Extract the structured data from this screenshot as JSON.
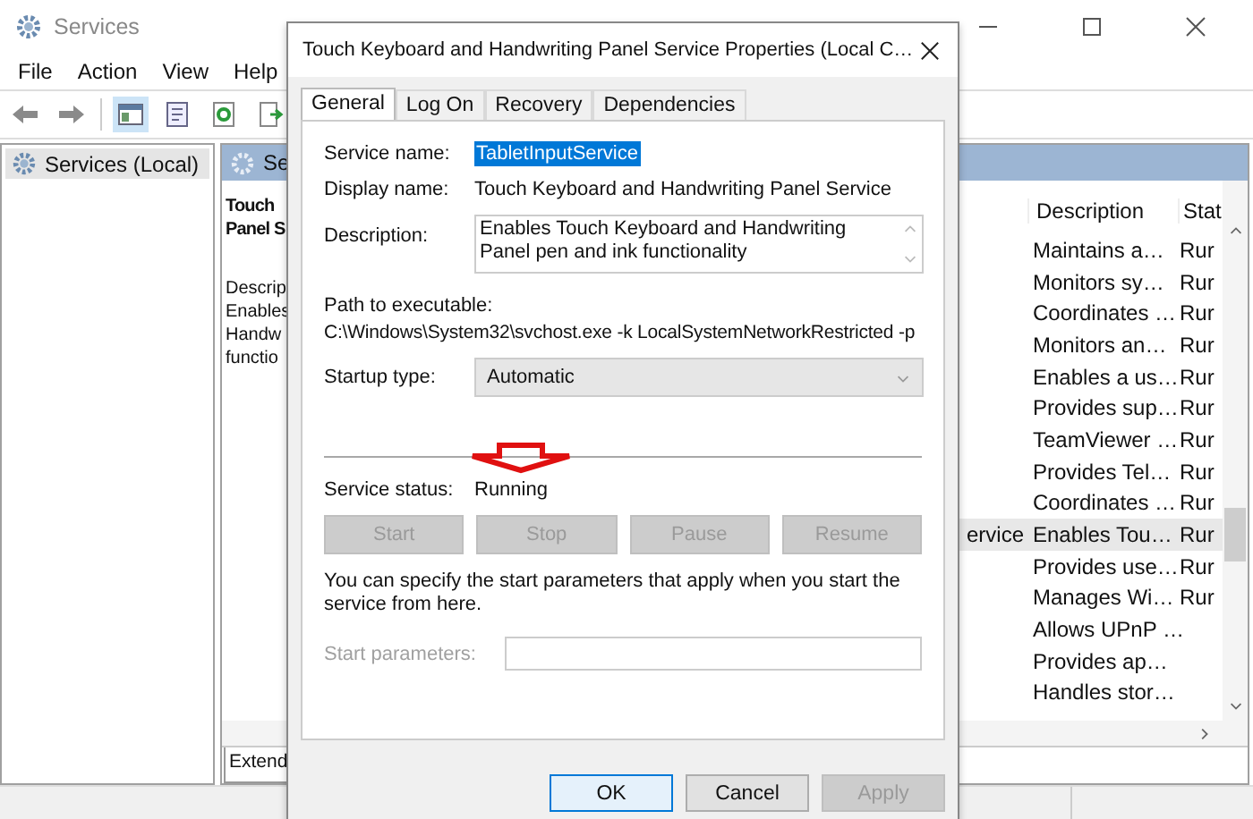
{
  "window": {
    "title": "Services"
  },
  "menu": [
    "File",
    "Action",
    "View",
    "Help"
  ],
  "tree": {
    "items": [
      {
        "label": "Services (Local)",
        "selected": true
      }
    ]
  },
  "panel": {
    "header": "Se",
    "detail_title": [
      "Touch",
      "Panel S"
    ],
    "detail_text": [
      "Descrip",
      "Enables",
      "Handw",
      "functio"
    ]
  },
  "list": {
    "columns": [
      "Description",
      "Stat"
    ],
    "rows": [
      {
        "description": "Maintains a…",
        "status": "Rur",
        "selected": false
      },
      {
        "description": "Monitors sy…",
        "status": "Rur",
        "selected": false
      },
      {
        "description": "Coordinates …",
        "status": "Rur",
        "selected": false
      },
      {
        "description": "Monitors an…",
        "status": "Rur",
        "selected": false
      },
      {
        "description": "Enables a us…",
        "status": "Rur",
        "selected": false
      },
      {
        "description": "Provides sup…",
        "status": "Rur",
        "selected": false
      },
      {
        "description": "TeamViewer …",
        "status": "Rur",
        "selected": false
      },
      {
        "description": "Provides Tel…",
        "status": "Rur",
        "selected": false
      },
      {
        "description": "Coordinates …",
        "status": "Rur",
        "selected": false
      },
      {
        "name": "ervice",
        "description": "Enables Tou…",
        "status": "Rur",
        "selected": true
      },
      {
        "description": "Provides use…",
        "status": "Rur",
        "selected": false
      },
      {
        "description": "Manages Wi…",
        "status": "Rur",
        "selected": false
      },
      {
        "description": "Allows UPnP …",
        "selected": false
      },
      {
        "description": "Provides ap…",
        "selected": false
      },
      {
        "description": "Handles stor…",
        "selected": false
      }
    ]
  },
  "bottom_tabs": [
    {
      "label": "Extend",
      "selected": true
    }
  ],
  "dialog": {
    "title": "Touch Keyboard and Handwriting Panel Service Properties (Local C…",
    "tabs": [
      {
        "label": "General",
        "selected": true
      },
      {
        "label": "Log On",
        "selected": false
      },
      {
        "label": "Recovery",
        "selected": false
      },
      {
        "label": "Dependencies",
        "selected": false
      }
    ],
    "service_name": {
      "label": "Service name:",
      "value": "TabletInputService"
    },
    "display_name": {
      "label": "Display name:",
      "value": "Touch Keyboard and Handwriting Panel Service"
    },
    "description": {
      "label": "Description:",
      "value": "Enables Touch Keyboard and Handwriting Panel pen and ink functionality"
    },
    "path": {
      "label": "Path to executable:",
      "value": "C:\\Windows\\System32\\svchost.exe -k LocalSystemNetworkRestricted -p"
    },
    "startup_type": {
      "label": "Startup type:",
      "value": "Automatic"
    },
    "service_status": {
      "label": "Service status:",
      "value": "Running"
    },
    "service_buttons": [
      {
        "label": "Start",
        "disabled": true
      },
      {
        "label": "Stop",
        "disabled": true
      },
      {
        "label": "Pause",
        "disabled": true
      },
      {
        "label": "Resume",
        "disabled": true
      }
    ],
    "hint": "You can specify the start parameters that apply when you start the service from here.",
    "start_parameters": {
      "label": "Start parameters:",
      "disabled": true
    },
    "buttons": [
      {
        "label": "OK",
        "default": true,
        "disabled": false
      },
      {
        "label": "Cancel",
        "default": false,
        "disabled": false
      },
      {
        "label": "Apply",
        "default": false,
        "disabled": true
      }
    ]
  }
}
